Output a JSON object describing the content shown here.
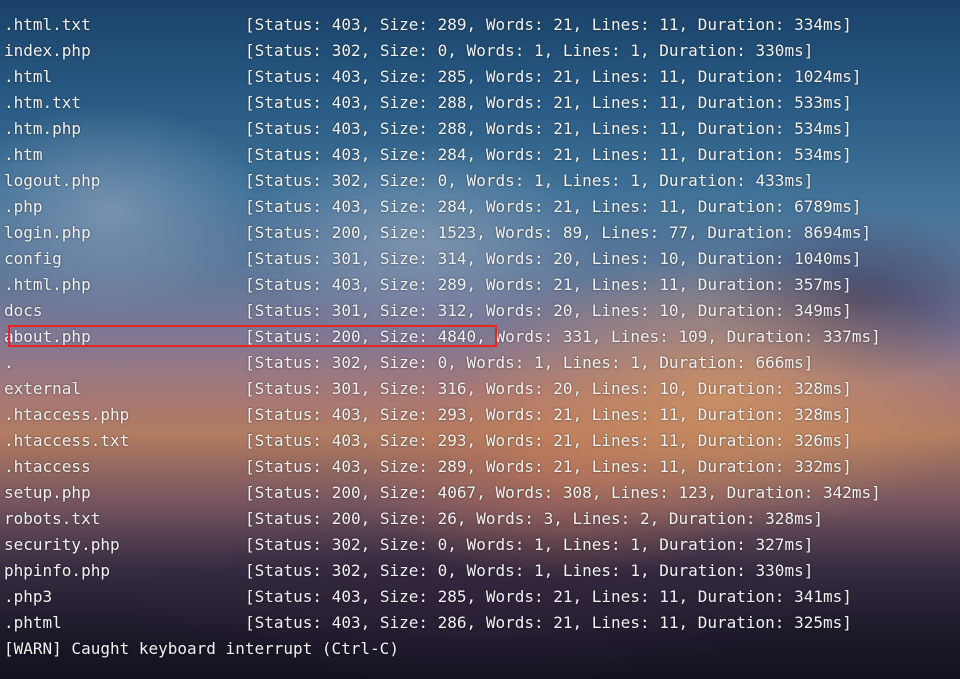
{
  "terminal": {
    "lines": [
      {
        "name": ".html.txt",
        "info": "[Status: 403, Size: 289, Words: 21, Lines: 11, Duration: 334ms]"
      },
      {
        "name": "index.php",
        "info": "[Status: 302, Size: 0, Words: 1, Lines: 1, Duration: 330ms]"
      },
      {
        "name": ".html",
        "info": "[Status: 403, Size: 285, Words: 21, Lines: 11, Duration: 1024ms]"
      },
      {
        "name": ".htm.txt",
        "info": "[Status: 403, Size: 288, Words: 21, Lines: 11, Duration: 533ms]"
      },
      {
        "name": ".htm.php",
        "info": "[Status: 403, Size: 288, Words: 21, Lines: 11, Duration: 534ms]"
      },
      {
        "name": ".htm",
        "info": "[Status: 403, Size: 284, Words: 21, Lines: 11, Duration: 534ms]"
      },
      {
        "name": "logout.php",
        "info": "[Status: 302, Size: 0, Words: 1, Lines: 1, Duration: 433ms]"
      },
      {
        "name": ".php",
        "info": "[Status: 403, Size: 284, Words: 21, Lines: 11, Duration: 6789ms]"
      },
      {
        "name": "login.php",
        "info": "[Status: 200, Size: 1523, Words: 89, Lines: 77, Duration: 8694ms]"
      },
      {
        "name": "config",
        "info": "[Status: 301, Size: 314, Words: 20, Lines: 10, Duration: 1040ms]"
      },
      {
        "name": ".html.php",
        "info": "[Status: 403, Size: 289, Words: 21, Lines: 11, Duration: 357ms]"
      },
      {
        "name": "docs",
        "info": "[Status: 301, Size: 312, Words: 20, Lines: 10, Duration: 349ms]"
      },
      {
        "name": "about.php",
        "info": "[Status: 200, Size: 4840, Words: 331, Lines: 109, Duration: 337ms]"
      },
      {
        "name": ".",
        "info": "[Status: 302, Size: 0, Words: 1, Lines: 1, Duration: 666ms]"
      },
      {
        "name": "external",
        "info": "[Status: 301, Size: 316, Words: 20, Lines: 10, Duration: 328ms]"
      },
      {
        "name": ".htaccess.php",
        "info": "[Status: 403, Size: 293, Words: 21, Lines: 11, Duration: 328ms]"
      },
      {
        "name": ".htaccess.txt",
        "info": "[Status: 403, Size: 293, Words: 21, Lines: 11, Duration: 326ms]"
      },
      {
        "name": ".htaccess",
        "info": "[Status: 403, Size: 289, Words: 21, Lines: 11, Duration: 332ms]"
      },
      {
        "name": "setup.php",
        "info": "[Status: 200, Size: 4067, Words: 308, Lines: 123, Duration: 342ms]"
      },
      {
        "name": "robots.txt",
        "info": "[Status: 200, Size: 26, Words: 3, Lines: 2, Duration: 328ms]"
      },
      {
        "name": "security.php",
        "info": "[Status: 302, Size: 0, Words: 1, Lines: 1, Duration: 327ms]"
      },
      {
        "name": "phpinfo.php",
        "info": "[Status: 302, Size: 0, Words: 1, Lines: 1, Duration: 330ms]"
      },
      {
        "name": ".php3",
        "info": "[Status: 403, Size: 285, Words: 21, Lines: 11, Duration: 341ms]"
      },
      {
        "name": ".phtml",
        "info": "[Status: 403, Size: 286, Words: 21, Lines: 11, Duration: 325ms]"
      }
    ],
    "warning": "[WARN] Caught keyboard interrupt (Ctrl-C)"
  },
  "colors": {
    "text": "#f2f2f2",
    "highlight_border": "#e8251c"
  }
}
